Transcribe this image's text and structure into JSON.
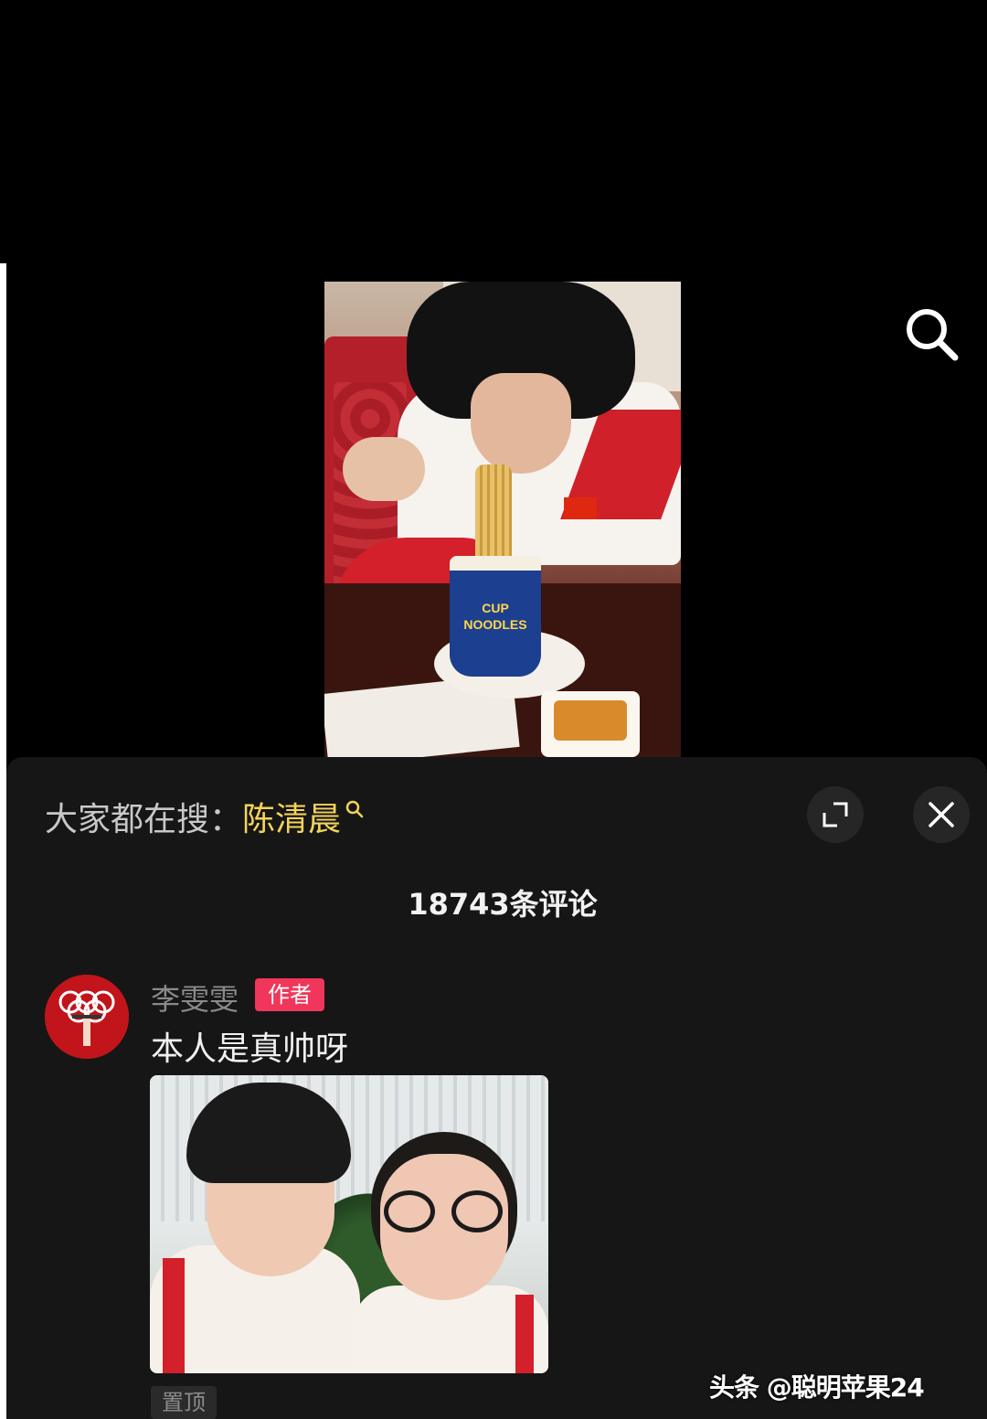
{
  "video": {
    "cup_label": "CUP NOODLES"
  },
  "comments_panel": {
    "search_prefix": "大家都在搜：",
    "search_term": "陈清晨",
    "comment_count": "18743条评论",
    "comment": {
      "username": "李雯雯",
      "badge": "作者",
      "text": "本人是真帅呀",
      "pin_label": "置顶"
    }
  },
  "watermark": "头条 @聪明苹果24",
  "colors": {
    "panel_bg": "#161616",
    "search_term": "#f3d35c",
    "author_badge": "#f0365a"
  },
  "icons": [
    "search-icon",
    "expand-icon",
    "close-icon",
    "magnifier-icon"
  ]
}
